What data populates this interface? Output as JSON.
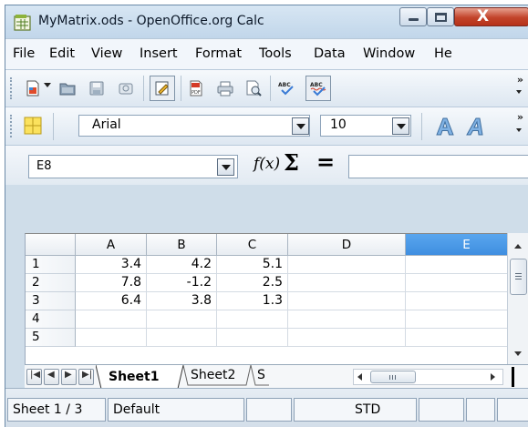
{
  "window": {
    "title": "MyMatrix.ods - OpenOffice.org Calc",
    "close_symbol": "X"
  },
  "menubar": {
    "items": [
      "File",
      "Edit",
      "View",
      "Insert",
      "Format",
      "Tools",
      "Data",
      "Window",
      "He"
    ]
  },
  "standard_toolbar": {
    "icons": [
      "new-document-icon",
      "open-folder-icon",
      "save-icon",
      "email-icon",
      "edit-mode-icon",
      "export-pdf-icon",
      "print-icon",
      "page-preview-icon",
      "spellcheck-icon",
      "autospellcheck-icon"
    ],
    "more_symbol": "»"
  },
  "formatting_toolbar": {
    "font_name": "Arial",
    "font_size": "10",
    "icons": [
      "styles-icon",
      "font-color-a-icon",
      "italic-a-icon"
    ],
    "more_symbol": "»"
  },
  "formula_bar": {
    "name_box": "E8",
    "fx_label": "f(x)",
    "sum_label": "Σ",
    "equals_label": "=",
    "input_value": ""
  },
  "grid": {
    "columns": [
      "A",
      "B",
      "C",
      "D",
      "E"
    ],
    "selected_column": "E",
    "rows": [
      {
        "num": "1",
        "cells": [
          "3.4",
          "4.2",
          "5.1",
          "",
          ""
        ]
      },
      {
        "num": "2",
        "cells": [
          "7.8",
          "-1.2",
          "2.5",
          "",
          ""
        ]
      },
      {
        "num": "3",
        "cells": [
          "6.4",
          "3.8",
          "1.3",
          "",
          ""
        ]
      },
      {
        "num": "4",
        "cells": [
          "",
          "",
          "",
          "",
          ""
        ]
      },
      {
        "num": "5",
        "cells": [
          "",
          "",
          "",
          "",
          ""
        ]
      }
    ]
  },
  "sheet_tabs": {
    "tabs": [
      "Sheet1",
      "Sheet2",
      "S"
    ],
    "active": "Sheet1"
  },
  "statusbar": {
    "sheet_position": "Sheet 1 / 3",
    "page_style": "Default",
    "mode": "STD"
  },
  "colors": {
    "selected_column_header": "#4a98e8",
    "window_frame": "#cfdde9",
    "close_button": "#c2432a"
  }
}
